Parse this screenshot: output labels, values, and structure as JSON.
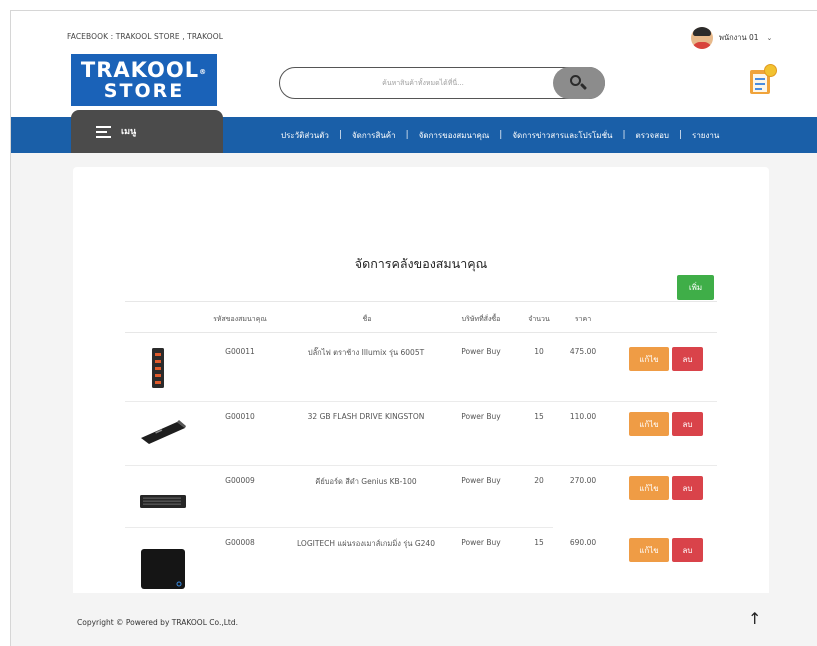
{
  "topbar": {
    "facebook_text": "FACEBOOK : TRAKOOL STORE , TRAKOOL",
    "user_name": "พนักงาน 01",
    "user_caret": "⌄"
  },
  "logo": {
    "line1": "TRAKOOL",
    "line2": "STORE",
    "reg": "®"
  },
  "search": {
    "placeholder": "ค้นหาสินค้าทั้งหมดได้ที่นี่...",
    "value": ""
  },
  "menu": {
    "label": "เมนู"
  },
  "nav": {
    "items": [
      "ประวัติส่วนตัว",
      "จัดการสินค้า",
      "จัดการของสมนาคุณ",
      "จัดการข่าวสารและโปรโมชั่น",
      "ตรวจสอบ",
      "รายงาน"
    ],
    "separator": "|"
  },
  "main": {
    "title": "จัดการคลังของสมนาคุณ",
    "add_label": "เพิ่ม",
    "columns": [
      "รหัสของสมนาคุณ",
      "ชื่อ",
      "บริษัทที่สั่งซื้อ",
      "จำนวน",
      "ราคา"
    ],
    "rows": [
      {
        "code": "G00011",
        "name": "ปลั๊กไฟ ตราช้าง Illumix รุ่น 6005T",
        "company": "Power Buy",
        "qty": "10",
        "price": "475.00",
        "edit": "แก้ไข",
        "delete": "ลบ"
      },
      {
        "code": "G00010",
        "name": "32 GB FLASH DRIVE KINGSTON",
        "company": "Power Buy",
        "qty": "15",
        "price": "110.00",
        "edit": "แก้ไข",
        "delete": "ลบ"
      },
      {
        "code": "G00009",
        "name": "คีย์บอร์ด สีดำ Genius KB-100",
        "company": "Power Buy",
        "qty": "20",
        "price": "270.00",
        "edit": "แก้ไข",
        "delete": "ลบ"
      },
      {
        "code": "G00008",
        "name": "LOGITECH แผ่นรองเมาส์เกมมิ่ง รุ่น G240",
        "company": "Power Buy",
        "qty": "15",
        "price": "690.00",
        "edit": "แก้ไข",
        "delete": "ลบ"
      }
    ]
  },
  "footer": {
    "copyright": "Copyright © Powered by TRAKOOL Co.,Ltd.",
    "up_arrow": "↑"
  },
  "colors": {
    "brand_blue": "#1a62b8",
    "nav_blue": "#1a5fa8",
    "menu_dark": "#4b4b4b",
    "add_green": "#3fae48",
    "edit_orange": "#ef9c45",
    "delete_red": "#d9434a"
  }
}
